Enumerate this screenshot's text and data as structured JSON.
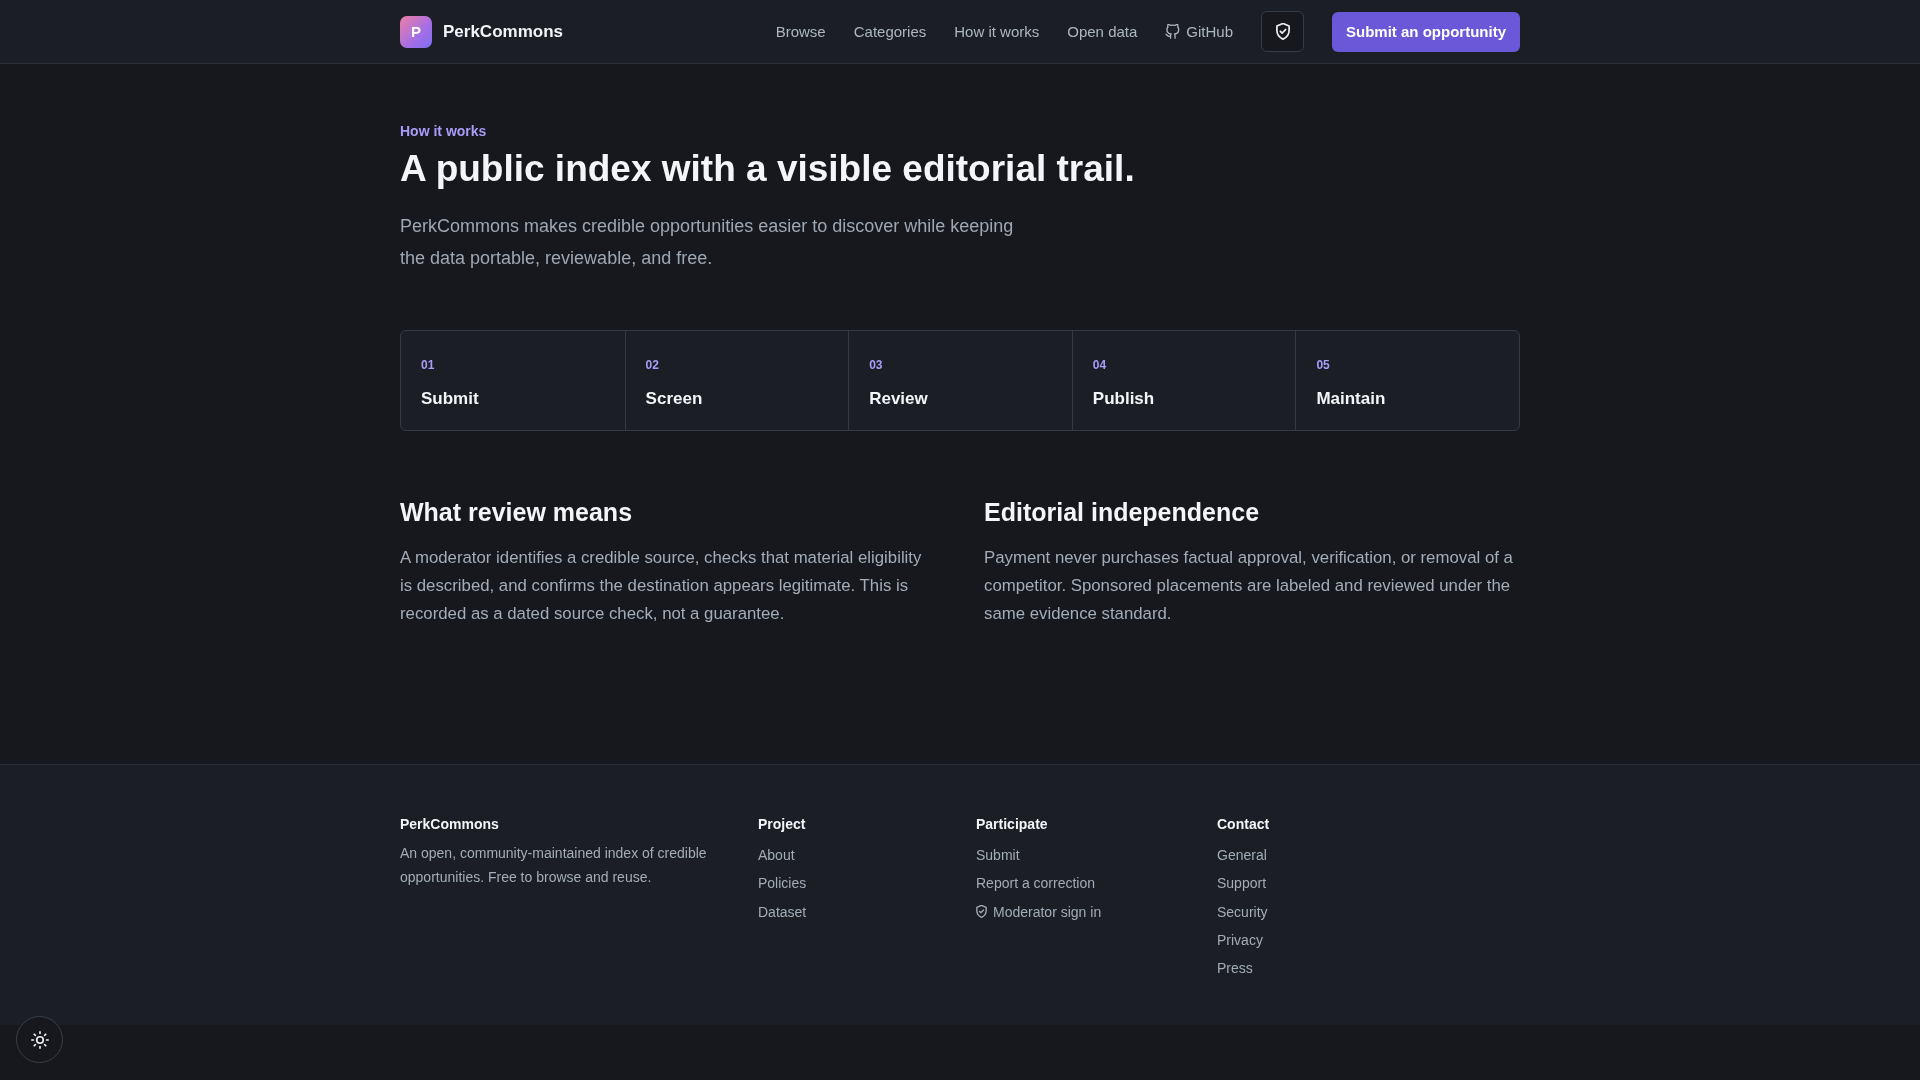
{
  "header": {
    "logo": {
      "letter": "P",
      "name": "PerkCommons"
    },
    "nav": [
      {
        "label": "Browse",
        "kind": "link"
      },
      {
        "label": "Categories",
        "kind": "link"
      },
      {
        "label": "How it works",
        "kind": "link"
      },
      {
        "label": "Open data",
        "kind": "link"
      },
      {
        "label": "GitHub",
        "kind": "github"
      }
    ],
    "buttons": [
      {
        "kind": "shield"
      },
      {
        "kind": "primary",
        "label": "Submit an opportunity"
      }
    ]
  },
  "hero": {
    "eyebrow": "How it works",
    "title": "A public index with a visible editorial trail.",
    "lead": "PerkCommons makes credible opportunities easier to discover while keeping the data portable, reviewable, and free."
  },
  "steps": [
    {
      "number": "01",
      "label": "Submit"
    },
    {
      "number": "02",
      "label": "Screen"
    },
    {
      "number": "03",
      "label": "Review"
    },
    {
      "number": "04",
      "label": "Publish"
    },
    {
      "number": "05",
      "label": "Maintain"
    }
  ],
  "sections": [
    {
      "title": "What review means",
      "body": "A moderator identifies a credible source, checks that material eligibility is described, and confirms the destination appears legitimate. This is recorded as a dated source check, not a guarantee."
    },
    {
      "title": "Editorial independence",
      "body": "Payment never purchases factual approval, verification, or removal of a competitor. Sponsored placements are labeled and reviewed under the same evidence standard."
    }
  ],
  "footer": {
    "brand": {
      "name": "PerkCommons",
      "description": "An open, community-maintained index of credible opportunities. Free to browse and reuse."
    },
    "columns": [
      {
        "title": "Project",
        "links": [
          {
            "label": "About",
            "kind": "plain"
          },
          {
            "label": "Policies",
            "kind": "plain"
          },
          {
            "label": "Dataset",
            "kind": "plain"
          }
        ]
      },
      {
        "title": "Participate",
        "links": [
          {
            "label": "Submit",
            "kind": "plain"
          },
          {
            "label": "Report a correction",
            "kind": "plain"
          },
          {
            "label": "Moderator sign in",
            "kind": "shielded"
          }
        ]
      },
      {
        "title": "Contact",
        "links": [
          {
            "label": "General",
            "kind": "plain"
          },
          {
            "label": "Support",
            "kind": "plain"
          },
          {
            "label": "Security",
            "kind": "plain"
          },
          {
            "label": "Privacy",
            "kind": "plain"
          },
          {
            "label": "Press",
            "kind": "plain"
          }
        ]
      }
    ]
  }
}
